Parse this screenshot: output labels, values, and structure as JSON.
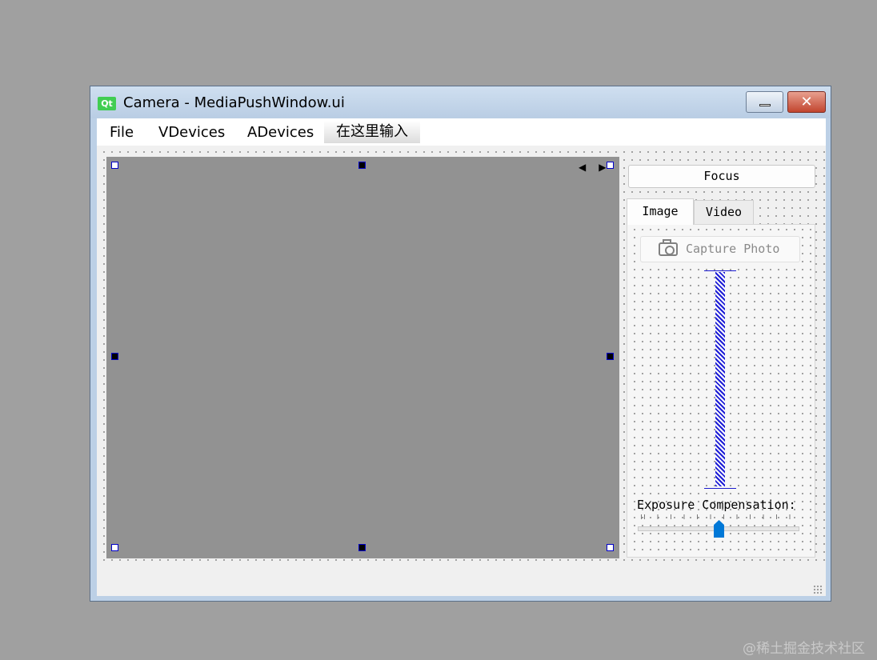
{
  "window": {
    "app_icon_text": "Qt",
    "title": "Camera - MediaPushWindow.ui",
    "controls": {
      "minimize": "minimize-icon",
      "close_icon": "close-icon",
      "close_glyph": "✕"
    }
  },
  "menubar": {
    "items": [
      {
        "label": "File"
      },
      {
        "label": "VDevices"
      },
      {
        "label": "ADevices"
      },
      {
        "label": "在这里输入"
      }
    ]
  },
  "viewfinder": {
    "background": "#929292",
    "nav_arrows": "◀▶"
  },
  "controls": {
    "focus_label": "Focus",
    "tabs": [
      {
        "label": "Image",
        "active": true
      },
      {
        "label": "Video",
        "active": false
      }
    ],
    "capture_photo_label": "Capture Photo",
    "exposure_label": "Exposure Compensation:",
    "exposure_value_fraction": 0.5
  },
  "colors": {
    "accent": "#0078d7",
    "selection_handle": "#0000c8",
    "zoom_track": "#1d1dd6"
  },
  "watermark": "@稀土掘金技术社区"
}
